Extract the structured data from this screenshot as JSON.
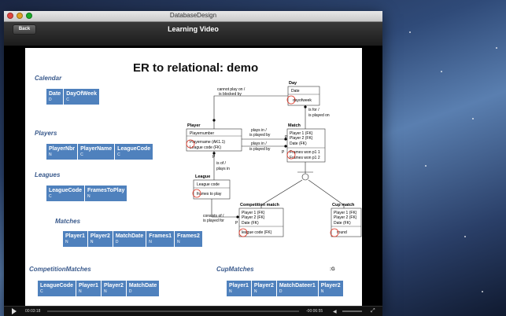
{
  "window": {
    "title": "DatabaseDesign"
  },
  "nav": {
    "back_label": "Back",
    "title": "Learning Video"
  },
  "slide": {
    "title": "ER to relational: demo",
    "sections": {
      "calendar": "Calendar",
      "players": "Players",
      "leagues": "Leagues",
      "matches": "Matches",
      "competition_matches": "CompetitionMatches",
      "cup_matches": "CupMatches",
      "cursor_mark": ":G"
    },
    "tables": {
      "calendar": [
        {
          "name": "Date",
          "type": "D"
        },
        {
          "name": "DayOfWeek",
          "type": "C"
        }
      ],
      "players": [
        {
          "name": "PlayerNbr",
          "type": "N"
        },
        {
          "name": "PlayerName",
          "type": "C"
        },
        {
          "name": "LeagueCode",
          "type": "C"
        }
      ],
      "leagues": [
        {
          "name": "LeagueCode",
          "type": "C"
        },
        {
          "name": "FramesToPlay",
          "type": "N"
        }
      ],
      "matches": [
        {
          "name": "Player1",
          "type": "N"
        },
        {
          "name": "Player2",
          "type": "N"
        },
        {
          "name": "MatchDate",
          "type": "D"
        },
        {
          "name": "Frames1",
          "type": "N"
        },
        {
          "name": "Frames2",
          "type": "N"
        }
      ],
      "competition_matches": [
        {
          "name": "LeagueCode",
          "type": "C"
        },
        {
          "name": "Player1",
          "type": "N"
        },
        {
          "name": "Player2",
          "type": "N"
        },
        {
          "name": "MatchDate",
          "type": "D"
        }
      ],
      "cup_matches": [
        {
          "name": "Player1",
          "type": "N"
        },
        {
          "name": "Player2",
          "type": "N"
        },
        {
          "name": "MatchDateer1",
          "type": "D"
        },
        {
          "name": "Player2",
          "type": "N"
        }
      ]
    },
    "er": {
      "day": {
        "title": "Day",
        "attrs": [
          "Date",
          "dayofweek"
        ]
      },
      "player": {
        "title": "Player",
        "attrs": [
          "Playernumber",
          "Playername (AK1.1)",
          "League code (FK)"
        ]
      },
      "match": {
        "title": "Match",
        "attrs": [
          "Player 1 (FK)",
          "Player 2 (FK)",
          "Date (FK)",
          "Frames won p1 1",
          "Frames won p1 2"
        ]
      },
      "league": {
        "title": "League",
        "attrs": [
          "League code",
          "frames to play"
        ]
      },
      "competition": {
        "title": "Competition match",
        "attrs": [
          "Player 1 (FK)",
          "Player 2 (FK)",
          "Date (FK)",
          "league code (FK)"
        ]
      },
      "cup": {
        "title": "Cup match",
        "attrs": [
          "Player 1 (FK)",
          "Player 2 (FK)",
          "Date (FK)",
          "round"
        ]
      },
      "labels": {
        "cannot_play": "cannot play on /",
        "blocked_by": "is blocked by",
        "plays_in_1": "plays in /",
        "played_by_1": "is played by",
        "plays_in_2": "plays in /",
        "played_by_2": "is played by",
        "is_for": "is for /",
        "played_on": "is played on",
        "is_of": "is of /",
        "plays_in_3": "plays in",
        "consists_of": "consists of /",
        "played_for": "is played for",
        "p": "P"
      }
    }
  },
  "controls": {
    "elapsed": "00:03:18",
    "remaining": "-00:06:55"
  }
}
